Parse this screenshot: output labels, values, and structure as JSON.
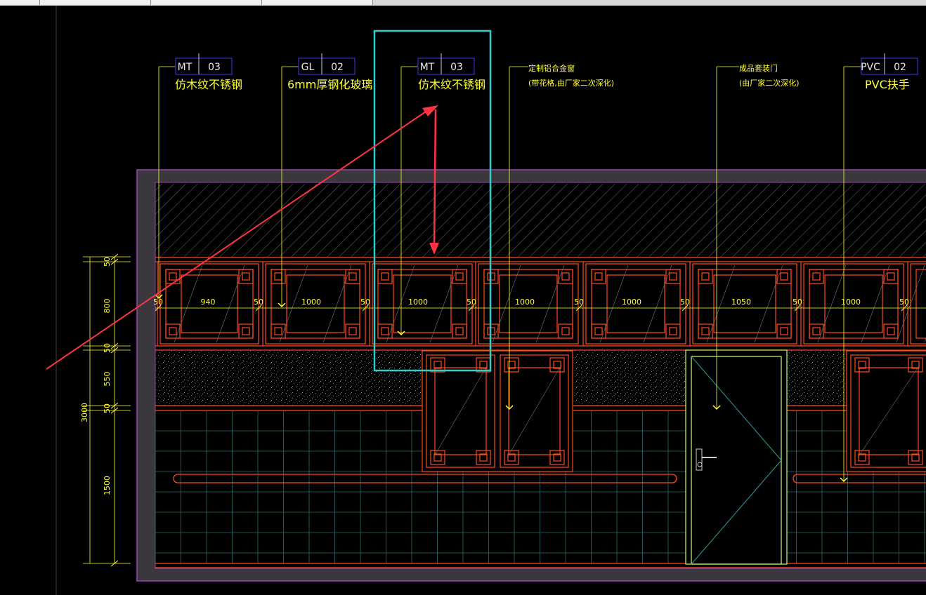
{
  "tabs": [
    {
      "label": "",
      "active": false
    },
    {
      "label": "",
      "active": false
    },
    {
      "label": "",
      "active": false
    },
    {
      "label": "",
      "active": false
    }
  ],
  "colors": {
    "background": "#000000",
    "frame_outer": "#3a383c",
    "frame_border": "#a040c0",
    "leader": "#ffff33",
    "tag_box": "#3333cc",
    "lattice": "#ff4a22",
    "tile_grid": "#2d6d6d",
    "door": "#c8ff66",
    "selection": "#33cccc",
    "arrow": "#ff3344"
  },
  "callouts": [
    {
      "code": "MT",
      "num": "03",
      "text": "仿木纹不锈钢"
    },
    {
      "code": "GL",
      "num": "02",
      "text": "6mm厚钢化玻璃"
    },
    {
      "code": "MT",
      "num": "03",
      "text": "仿木纹不锈钢"
    },
    {
      "code": "",
      "num": "",
      "text": "定制铝合金窗",
      "text2": "(带花格,由厂家二次深化)"
    },
    {
      "code": "",
      "num": "",
      "text": "成品套装门",
      "text2": "(由厂家二次深化)"
    },
    {
      "code": "PVC",
      "num": "02",
      "text": "PVC扶手"
    }
  ],
  "horizontal_dims": [
    "50",
    "940",
    "50",
    "1000",
    "50",
    "1000",
    "50",
    "1000",
    "50",
    "1000",
    "50",
    "1050",
    "50",
    "1000",
    "50"
  ],
  "vertical_dims": {
    "segments": [
      "50",
      "800",
      "50",
      "550",
      "50",
      "1500"
    ],
    "total": "3000"
  },
  "door_handle_symbol": "Φ"
}
